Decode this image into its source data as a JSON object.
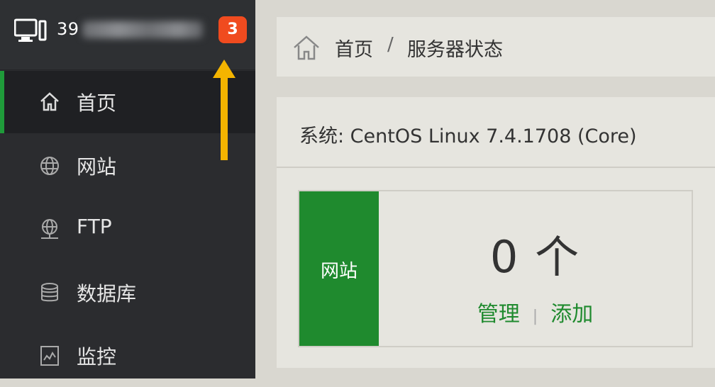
{
  "sidebar": {
    "server_ip": "39",
    "badge_count": "3",
    "items": [
      {
        "label": "首页",
        "icon": "home-icon",
        "active": true
      },
      {
        "label": "网站",
        "icon": "globe-icon",
        "active": false
      },
      {
        "label": "FTP",
        "icon": "ftp-icon",
        "active": false
      },
      {
        "label": "数据库",
        "icon": "database-icon",
        "active": false
      },
      {
        "label": "监控",
        "icon": "monitor-chart-icon",
        "active": false
      }
    ]
  },
  "breadcrumb": {
    "home": "首页",
    "separator": "/",
    "current": "服务器状态"
  },
  "panel": {
    "system": "系统: CentOS Linux 7.4.1708 (Core)",
    "card": {
      "title": "网站",
      "count": "0 个",
      "manage": "管理",
      "divider": "|",
      "add": "添加"
    }
  },
  "colors": {
    "accent_green": "#1f8a2e",
    "badge_red": "#f04b1f",
    "arrow_yellow": "#f4b400"
  }
}
